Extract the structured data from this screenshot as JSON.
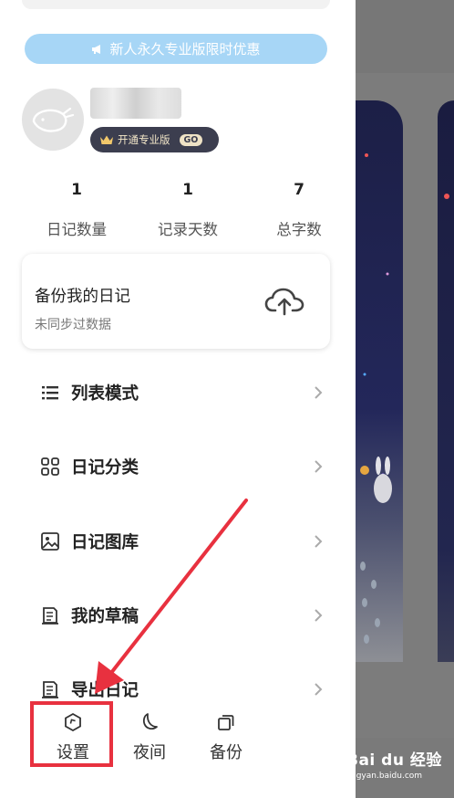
{
  "promo": {
    "label": "新人永久专业版限时优惠"
  },
  "profile": {
    "pro_badge": "开通专业版",
    "go_label": "GO"
  },
  "stats": [
    {
      "value": "1",
      "label": "日记数量"
    },
    {
      "value": "1",
      "label": "记录天数"
    },
    {
      "value": "7",
      "label": "总字数"
    }
  ],
  "backup_card": {
    "title": "备份我的日记",
    "subtitle": "未同步过数据"
  },
  "menu": [
    {
      "label": "列表模式",
      "icon": "list-icon"
    },
    {
      "label": "日记分类",
      "icon": "grid-icon"
    },
    {
      "label": "日记图库",
      "icon": "image-icon"
    },
    {
      "label": "我的草稿",
      "icon": "draft-icon"
    },
    {
      "label": "导出日记",
      "icon": "export-icon"
    }
  ],
  "bottom_bar": [
    {
      "label": "设置",
      "icon": "settings-hexagon-icon"
    },
    {
      "label": "夜间",
      "icon": "moon-icon"
    },
    {
      "label": "备份",
      "icon": "copy-icon"
    }
  ],
  "watermark": {
    "brand": "Bai du 经验",
    "url": "jingyan.baidu.com"
  },
  "colors": {
    "promo_bg": "#a7d6f6",
    "badge_bg": "#3c3e4f",
    "annotation_red": "#e8313f"
  }
}
